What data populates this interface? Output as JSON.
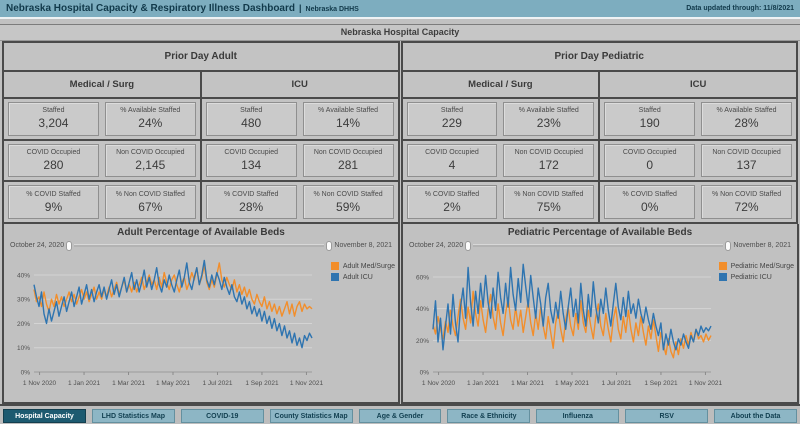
{
  "topbar": {
    "title": "Nebraska Hospital Capacity & Respiratory Illness Dashboard",
    "separator": "|",
    "subtitle": "Nebraska DHHS",
    "updated": "Data updated through: 11/8/2021"
  },
  "section_title": "Nebraska Hospital Capacity",
  "colors": {
    "orange": "#f28e2b",
    "blue": "#2e74b0",
    "header_bg": "#7dadbf",
    "active_tab": "#1d5a70",
    "inactive_tab": "#8db6c5"
  },
  "panels": [
    {
      "title": "Prior Day Adult",
      "groups": [
        {
          "title": "Medical / Surg",
          "stats": [
            {
              "label": "Staffed",
              "value": "3,204"
            },
            {
              "label": "% Available Staffed",
              "value": "24%"
            },
            {
              "label": "COVID Occupied",
              "value": "280"
            },
            {
              "label": "Non COVID Occupied",
              "value": "2,145"
            },
            {
              "label": "% COVID Staffed",
              "value": "9%"
            },
            {
              "label": "% Non COVID Staffed",
              "value": "67%"
            }
          ]
        },
        {
          "title": "ICU",
          "stats": [
            {
              "label": "Staffed",
              "value": "480"
            },
            {
              "label": "% Available Staffed",
              "value": "14%"
            },
            {
              "label": "COVID Occupied",
              "value": "134"
            },
            {
              "label": "Non COVID Occupied",
              "value": "281"
            },
            {
              "label": "% COVID Staffed",
              "value": "28%"
            },
            {
              "label": "% Non COVID Staffed",
              "value": "59%"
            }
          ]
        }
      ]
    },
    {
      "title": "Prior Day Pediatric",
      "groups": [
        {
          "title": "Medical / Surg",
          "stats": [
            {
              "label": "Staffed",
              "value": "229"
            },
            {
              "label": "% Available Staffed",
              "value": "23%"
            },
            {
              "label": "COVID Occupied",
              "value": "4"
            },
            {
              "label": "Non COVID Occupied",
              "value": "172"
            },
            {
              "label": "% COVID Staffed",
              "value": "2%"
            },
            {
              "label": "% Non COVID Staffed",
              "value": "75%"
            }
          ]
        },
        {
          "title": "ICU",
          "stats": [
            {
              "label": "Staffed",
              "value": "190"
            },
            {
              "label": "% Available Staffed",
              "value": "28%"
            },
            {
              "label": "COVID Occupied",
              "value": "0"
            },
            {
              "label": "Non COVID Occupied",
              "value": "137"
            },
            {
              "label": "% COVID Staffed",
              "value": "0%"
            },
            {
              "label": "% Non COVID Staffed",
              "value": "72%"
            }
          ]
        }
      ]
    }
  ],
  "chart_data": [
    {
      "type": "line",
      "title": "Adult Percentage of Available Beds",
      "xlabel": "",
      "ylabel": "",
      "grid": true,
      "legend_position": "top-right",
      "slider": {
        "start_label": "October 24, 2020",
        "end_label": "November 8, 2021"
      },
      "ylim": [
        0,
        47
      ],
      "yticks": [
        {
          "value": 0,
          "label": "0%"
        },
        {
          "value": 10,
          "label": "10%"
        },
        {
          "value": 20,
          "label": "20%"
        },
        {
          "value": 30,
          "label": "30%"
        },
        {
          "value": 40,
          "label": "40%"
        }
      ],
      "xticks": [
        {
          "frac": 0.02,
          "label": "1 Nov 2020"
        },
        {
          "frac": 0.18,
          "label": "1 Jan 2021"
        },
        {
          "frac": 0.34,
          "label": "1 Mar 2021"
        },
        {
          "frac": 0.5,
          "label": "1 May 2021"
        },
        {
          "frac": 0.66,
          "label": "1 Jul 2021"
        },
        {
          "frac": 0.82,
          "label": "1 Sep 2021"
        },
        {
          "frac": 0.98,
          "label": "1 Nov 2021"
        }
      ],
      "series": [
        {
          "name": "Adult Med/Surge",
          "color": "#f28e2b",
          "values": [
            34,
            29,
            31,
            27,
            33,
            28,
            25,
            30,
            27,
            32,
            28,
            31,
            27,
            30,
            33,
            29,
            32,
            28,
            31,
            34,
            30,
            33,
            29,
            32,
            35,
            30,
            33,
            30,
            34,
            31,
            35,
            31,
            34,
            37,
            32,
            35,
            38,
            33,
            36,
            33,
            37,
            33,
            36,
            39,
            34,
            37,
            40,
            36,
            38,
            34,
            39,
            35,
            41,
            37,
            34,
            38,
            40,
            36,
            33,
            37,
            39,
            34,
            37,
            41,
            38,
            43,
            36,
            39,
            44,
            37,
            34,
            38,
            35,
            40,
            45,
            38,
            35,
            39,
            36,
            34,
            38,
            33,
            36,
            32,
            35,
            31,
            34,
            30,
            28,
            32,
            29,
            27,
            31,
            26,
            29,
            25,
            28,
            24,
            27,
            23,
            26,
            29,
            24,
            28,
            23,
            27,
            29,
            25,
            28,
            26,
            27,
            26
          ]
        },
        {
          "name": "Adult ICU",
          "color": "#2e74b0",
          "values": [
            36,
            31,
            27,
            33,
            24,
            20,
            26,
            21,
            25,
            29,
            23,
            27,
            31,
            25,
            29,
            33,
            27,
            31,
            35,
            28,
            32,
            36,
            30,
            34,
            29,
            33,
            36,
            31,
            35,
            30,
            34,
            38,
            32,
            36,
            31,
            35,
            39,
            33,
            37,
            41,
            34,
            38,
            33,
            37,
            42,
            35,
            39,
            34,
            38,
            43,
            36,
            33,
            38,
            35,
            40,
            36,
            33,
            38,
            42,
            35,
            39,
            45,
            37,
            34,
            39,
            43,
            36,
            40,
            46,
            38,
            35,
            40,
            36,
            41,
            38,
            34,
            39,
            35,
            32,
            36,
            31,
            29,
            33,
            28,
            31,
            26,
            29,
            24,
            27,
            23,
            26,
            21,
            25,
            20,
            23,
            18,
            22,
            17,
            20,
            15,
            19,
            14,
            17,
            12,
            16,
            11,
            14,
            10,
            15,
            13,
            16,
            14
          ]
        }
      ]
    },
    {
      "type": "line",
      "title": "Pediatric Percentage of Available Beds",
      "xlabel": "",
      "ylabel": "",
      "grid": true,
      "legend_position": "top-right",
      "slider": {
        "start_label": "October 24, 2020",
        "end_label": "November 8, 2021"
      },
      "ylim": [
        0,
        72
      ],
      "yticks": [
        {
          "value": 0,
          "label": "0%"
        },
        {
          "value": 20,
          "label": "20%"
        },
        {
          "value": 40,
          "label": "40%"
        },
        {
          "value": 60,
          "label": "60%"
        }
      ],
      "xticks": [
        {
          "frac": 0.02,
          "label": "1 Nov 2020"
        },
        {
          "frac": 0.18,
          "label": "1 Jan 2021"
        },
        {
          "frac": 0.34,
          "label": "1 Mar 2021"
        },
        {
          "frac": 0.5,
          "label": "1 May 2021"
        },
        {
          "frac": 0.66,
          "label": "1 Jul 2021"
        },
        {
          "frac": 0.82,
          "label": "1 Sep 2021"
        },
        {
          "frac": 0.98,
          "label": "1 Nov 2021"
        }
      ],
      "series": [
        {
          "name": "Pediatric Med/Surge",
          "color": "#f28e2b",
          "values": [
            30,
            24,
            35,
            27,
            21,
            32,
            25,
            39,
            29,
            23,
            35,
            46,
            34,
            27,
            41,
            31,
            51,
            37,
            29,
            45,
            33,
            25,
            39,
            49,
            35,
            27,
            43,
            31,
            23,
            37,
            47,
            33,
            27,
            41,
            29,
            39,
            25,
            35,
            45,
            31,
            23,
            37,
            27,
            41,
            29,
            21,
            35,
            25,
            15,
            31,
            39,
            27,
            19,
            33,
            41,
            29,
            23,
            37,
            27,
            45,
            31,
            25,
            39,
            29,
            21,
            35,
            43,
            29,
            23,
            37,
            27,
            19,
            33,
            41,
            27,
            21,
            35,
            25,
            39,
            27,
            19,
            31,
            23,
            35,
            25,
            17,
            29,
            21,
            33,
            23,
            13,
            25,
            17,
            11,
            21,
            13,
            9,
            19,
            11,
            21,
            15,
            23,
            17,
            25,
            19,
            27,
            21,
            23,
            19,
            24,
            20,
            23
          ]
        },
        {
          "name": "Pediatric ICU",
          "color": "#2e74b0",
          "values": [
            27,
            45,
            19,
            34,
            14,
            29,
            43,
            24,
            49,
            31,
            19,
            41,
            53,
            34,
            66,
            44,
            29,
            51,
            37,
            56,
            41,
            61,
            44,
            34,
            53,
            39,
            63,
            47,
            37,
            56,
            41,
            66,
            49,
            39,
            59,
            44,
            68,
            54,
            41,
            61,
            47,
            34,
            53,
            43,
            29,
            47,
            56,
            39,
            31,
            44,
            34,
            51,
            37,
            27,
            41,
            53,
            35,
            46,
            31,
            56,
            39,
            29,
            49,
            35,
            57,
            41,
            31,
            46,
            37,
            53,
            39,
            29,
            43,
            56,
            41,
            33,
            47,
            35,
            51,
            37,
            43,
            34,
            46,
            37,
            31,
            41,
            33,
            27,
            37,
            29,
            23,
            31,
            14,
            24,
            17,
            27,
            19,
            14,
            21,
            17,
            24,
            19,
            15,
            23,
            19,
            27,
            23,
            29,
            25,
            28,
            26,
            29
          ]
        }
      ]
    }
  ],
  "tabs": [
    {
      "label": "Hospital Capacity",
      "active": true
    },
    {
      "label": "LHD Statistics Map",
      "active": false
    },
    {
      "label": "COVID-19",
      "active": false
    },
    {
      "label": "County Statistics Map",
      "active": false
    },
    {
      "label": "Age & Gender",
      "active": false
    },
    {
      "label": "Race & Ethnicity",
      "active": false
    },
    {
      "label": "Influenza",
      "active": false
    },
    {
      "label": "RSV",
      "active": false
    },
    {
      "label": "About the Data",
      "active": false
    }
  ]
}
